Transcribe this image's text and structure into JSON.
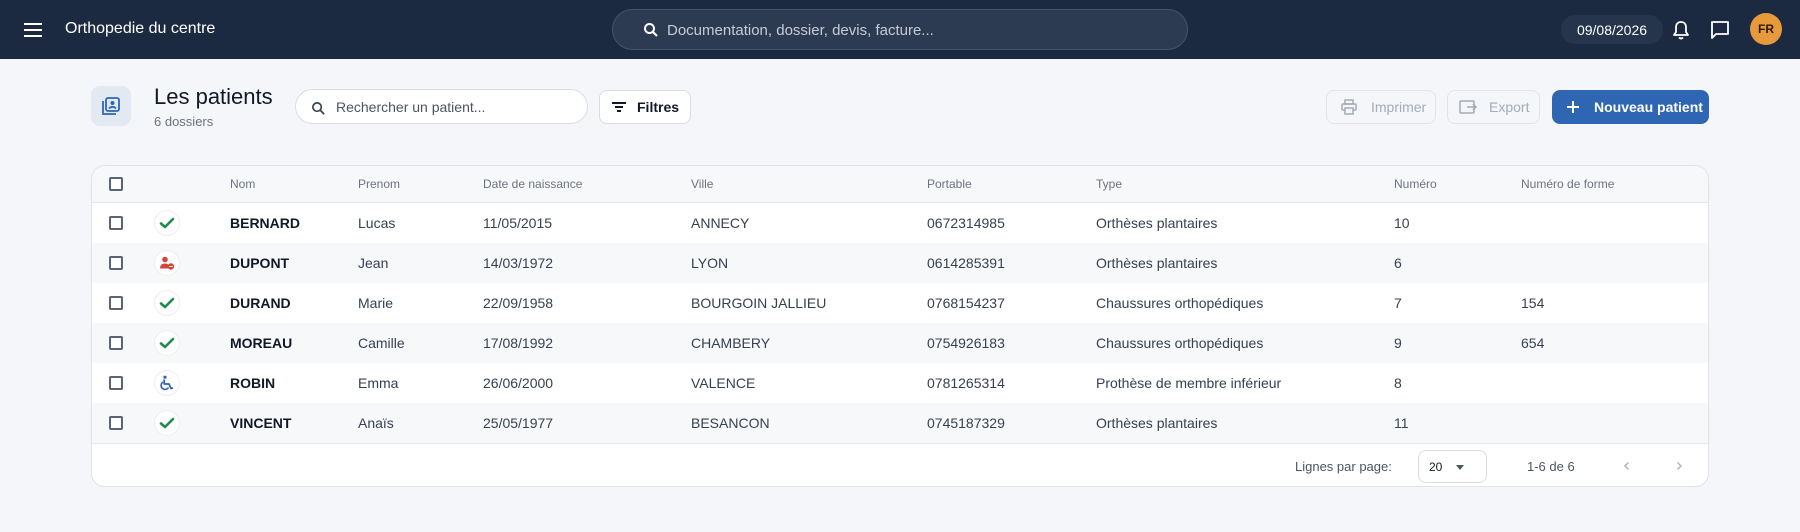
{
  "topbar": {
    "app_title": "Orthopedie du centre",
    "search_placeholder": "Documentation, dossier, devis, facture...",
    "date": "09/08/2026",
    "avatar_initials": "FR",
    "avatar_color": "#e79a3c"
  },
  "header": {
    "title": "Les patients",
    "subtitle": "6 dossiers",
    "search_placeholder": "Rechercher un patient...",
    "filters_label": "Filtres",
    "print_label": "Imprimer",
    "export_label": "Export",
    "new_label": "Nouveau patient",
    "accent_color": "#2f66b3"
  },
  "table": {
    "columns": [
      "Nom",
      "Prenom",
      "Date de naissance",
      "Ville",
      "Portable",
      "Type",
      "Numéro",
      "Numéro de forme"
    ],
    "rows": [
      {
        "status_icon": "check-icon",
        "nom": "BERNARD",
        "prenom": "Lucas",
        "naissance": "11/05/2015",
        "ville": "ANNECY",
        "portable": "0672314985",
        "type": "Orthèses plantaires",
        "numero": "10",
        "forme": ""
      },
      {
        "status_icon": "person-alert-icon",
        "nom": "DUPONT",
        "prenom": "Jean",
        "naissance": "14/03/1972",
        "ville": "LYON",
        "portable": "0614285391",
        "type": "Orthèses plantaires",
        "numero": "6",
        "forme": ""
      },
      {
        "status_icon": "check-icon",
        "nom": "DURAND",
        "prenom": "Marie",
        "naissance": "22/09/1958",
        "ville": "BOURGOIN JALLIEU",
        "portable": "0768154237",
        "type": "Chaussures orthopédiques",
        "numero": "7",
        "forme": "154"
      },
      {
        "status_icon": "check-icon",
        "nom": "MOREAU",
        "prenom": "Camille",
        "naissance": "17/08/1992",
        "ville": "CHAMBERY",
        "portable": "0754926183",
        "type": "Chaussures orthopédiques",
        "numero": "9",
        "forme": "654"
      },
      {
        "status_icon": "wheelchair-icon",
        "nom": "ROBIN",
        "prenom": "Emma",
        "naissance": "26/06/2000",
        "ville": "VALENCE",
        "portable": "0781265314",
        "type": "Prothèse de membre inférieur",
        "numero": "8",
        "forme": ""
      },
      {
        "status_icon": "check-icon",
        "nom": "VINCENT",
        "prenom": "Anaïs",
        "naissance": "25/05/1977",
        "ville": "BESANCON",
        "portable": "0745187329",
        "type": "Orthèses plantaires",
        "numero": "11",
        "forme": ""
      }
    ]
  },
  "footer": {
    "rows_per_page_label": "Lignes par page:",
    "rows_per_page_value": "20",
    "range": "1-6 de 6"
  },
  "colors": {
    "check": "#1f8a4c",
    "alert": "#d6453d",
    "wheelchair": "#2f66b3"
  }
}
